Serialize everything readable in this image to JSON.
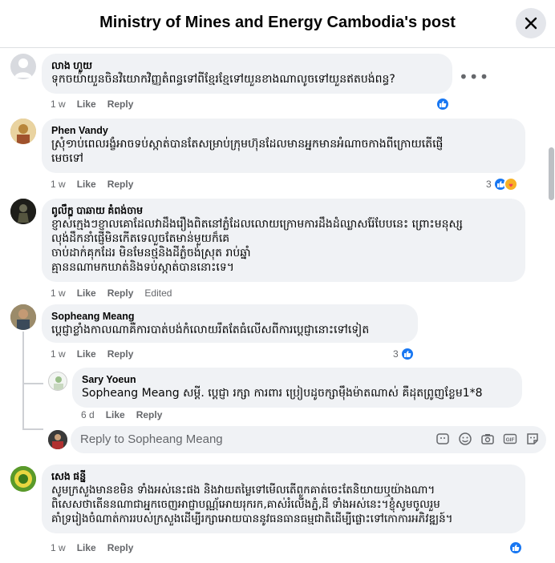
{
  "header": {
    "title": "Ministry of Mines and Energy Cambodia's post"
  },
  "actions": {
    "like": "Like",
    "reply": "Reply"
  },
  "comments": [
    {
      "author": "លាង ហួយ",
      "text": "ទុកចយ៉ាយួនចិនវិយោកវិញ្ញតំពន្ធទៅពីខ្មែរខ្មែទៅយួនខាងណាលូចទៅយួនឥតបង់ពន្ធ?",
      "time": "1 w",
      "reactions": ""
    },
    {
      "author": "Phen Vandy",
      "text": "ស្រុំ១ាប់ពេលរង្ខំអាចទប់ស្កាត់បានតែសម្រាប់ក្រុមហ៊ុនដែលមានអ្នកមានអំណាចកាងពីក្រោយតើផ្ញើ\nមេចទៅ",
      "time": "1 w",
      "reactions": "3"
    },
    {
      "author": "ពូលឹក្ខ បាឆាយ គំពង់ចាម",
      "text": "ខ្ញាស់ក្មេងៗខ្ញាលគោដែលវាដឹងរឿងពិតនៅភ្លំដែលលោយក្រោមការដឹងដំឈ្លាសរ៉ែបែបនេះ ព្រោះមនុស្ស\nលុង់ដឹកនាំផ្ញើមិនកើតទេលួចតែមាន់មួយក៏គេ\nចាប់ដាក់គុកដែរ មិនមែនថ្មនិងដីភ្លំចង់ស្រុត រាប់ឆ្នាំ\nគ្មាននណាមកឃាត់និងទប់ស្កាត់បាននោះទេ។",
      "time": "1 w",
      "edited": "Edited",
      "reactions": ""
    },
    {
      "author": "Sopheang Meang",
      "text": "ប្ដេជ្ញាខ្លាំងកាលណាគឺការបាត់បង់កំលោយរឹតតែធំលើសពីការប្ដេជ្ញានោះទៅទៀត",
      "time": "1 w",
      "reactions": "3"
    }
  ],
  "nested_reply": {
    "author": "Sary Yoeun",
    "mention": "Sopheang Meang",
    "text": " សម្តី. ប្តេជ្ញា រក្សា ការពារ ប្រៀបដូចក្សាម៉ឹងម៉ាតណាស់ គឺដុតព្រូញខែ្លម1*8",
    "time": "6 d"
  },
  "reply_input": {
    "placeholder": "Reply to Sopheang Meang"
  },
  "last_comment": {
    "author": "សេង ផន្នី",
    "text": "សូមក្រសួងមានខមិន ទាំងអស់នេះផង និងវាយតម្លៃទៅមើលតើពួកគាត់ចេះតែនិយាយឬយ៉ាងណា។\nពិសេសថាតើននណាជាអ្នកចេញអាជ្ញាបណ្ណ័អោយរុករក,គាស់រំលើងភ្នំ,ដី ទាំងអស់នេះ។ខ្ញុំសូមចូលរួម\nគាំទ្ររៀងចំណាត់ការរបស់ក្រសួងដើម្បីរក្សាអោយបាននូវធនធានធម្មជាតិដើម្បីផ្លោះទៅកោការអភិវឌ្ឍន៍។",
    "time": "1 w",
    "reactions": ""
  },
  "icons": [
    "close-icon",
    "more-options-icon",
    "like-reaction-icon",
    "love-reaction-icon",
    "emoji-icon",
    "gif-icon",
    "sticker-icon",
    "camera-icon"
  ],
  "colors": {
    "accent": "#1877f2",
    "bubble": "#f0f2f5",
    "meta": "#65676b"
  }
}
